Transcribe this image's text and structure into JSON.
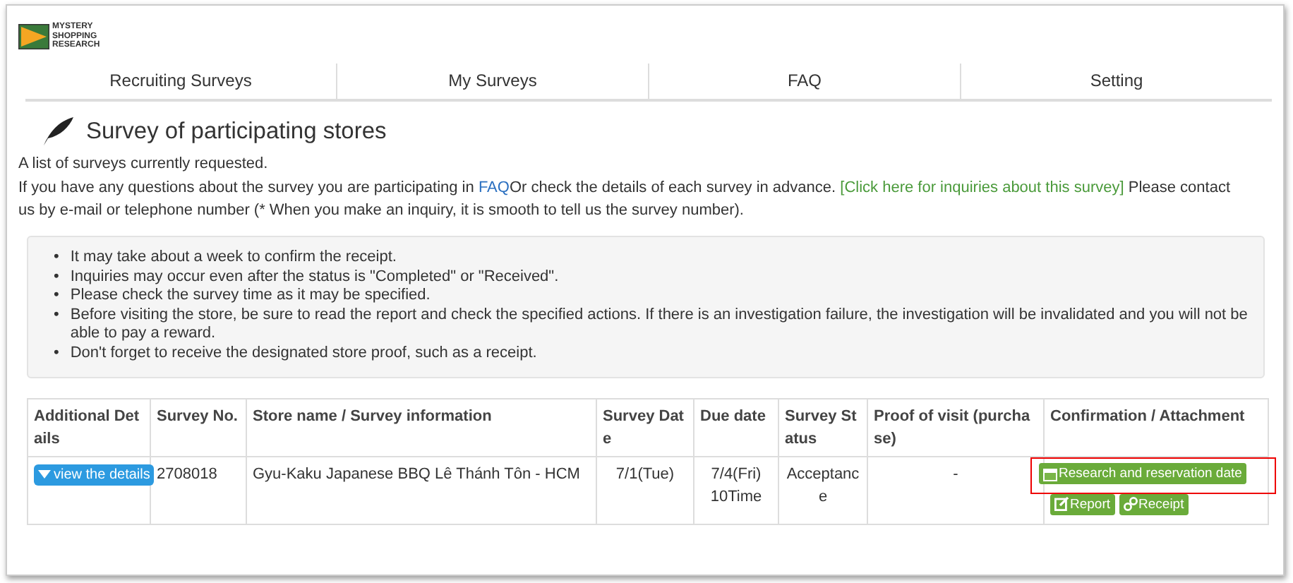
{
  "logo": {
    "lines": [
      "MYSTERY",
      "SHOPPING",
      "RESEARCH"
    ]
  },
  "nav": [
    {
      "label": "Recruiting Surveys"
    },
    {
      "label": "My Surveys"
    },
    {
      "label": "FAQ"
    },
    {
      "label": "Setting"
    }
  ],
  "heading": "Survey of participating stores",
  "intro": "A list of surveys currently requested.",
  "help": {
    "before": "If you have any questions about the survey you are participating in ",
    "faq_link": "FAQ",
    "middle": "Or check the details of each survey in advance. ",
    "inquiry_link": "[Click here for inquiries about this survey]",
    "after": " Please contact us by e-mail or telephone number (* When you make an inquiry, it is smooth to tell us the survey number)."
  },
  "notes": [
    {
      "bullet": "•",
      "text": "It may take about a week to confirm the receipt."
    },
    {
      "bullet": "•",
      "text": "Inquiries may occur even after the status is \"Completed\" or \"Received\"."
    },
    {
      "bullet": "•",
      "text": "Please check the survey time as it may be specified."
    },
    {
      "bullet": "•",
      "text": "Before visiting the store, be sure to read the report and check the specified actions. If there is an investigation failure, the investigation will be invalidated and you will not be able to pay a reward."
    },
    {
      "bullet": "•",
      "text": "Don't forget to receive the designated store proof, such as a receipt."
    }
  ],
  "table": {
    "columns": [
      "Additional Details",
      "Survey No.",
      "Store name / Survey information",
      "Survey Date",
      "Due date",
      "Survey Status",
      "Proof of visit (purchase)",
      "Confirmation / Attachment"
    ],
    "rows": [
      {
        "details_button": "view the details",
        "survey_no": "2708018",
        "store": "Gyu-Kaku Japanese BBQ Lê Thánh Tôn - HCM",
        "survey_date": "7/1(Tue)",
        "due_date": "7/4(Fri) 10Time",
        "status": "Acceptance",
        "proof": "-",
        "actions": [
          {
            "kind": "calendar",
            "label": "Research and reservation date",
            "highlighted": true
          },
          {
            "kind": "edit",
            "label": "Report",
            "highlighted": false
          },
          {
            "kind": "link",
            "label": "Receipt",
            "highlighted": false
          }
        ]
      }
    ]
  }
}
